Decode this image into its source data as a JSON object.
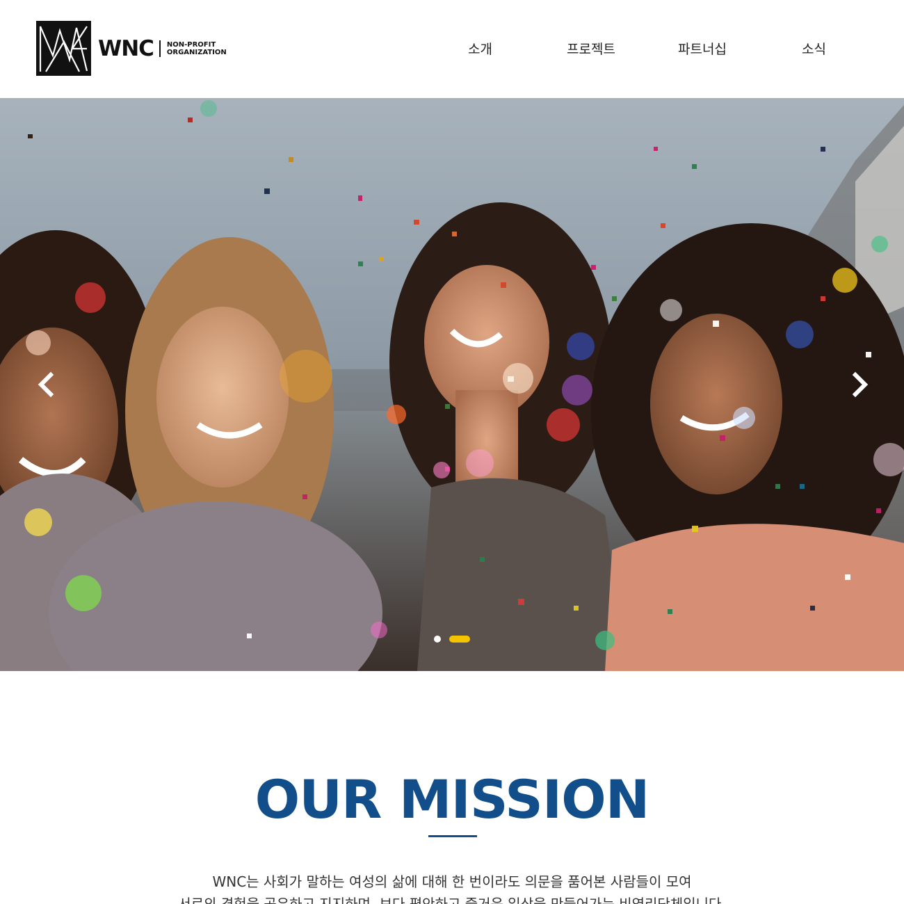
{
  "header": {
    "logo_text": "WNC",
    "logo_sub_line1": "NON-PROFIT",
    "logo_sub_line2": "ORGANIZATION",
    "nav": [
      "소개",
      "프로젝트",
      "파트너십",
      "소식"
    ]
  },
  "hero": {
    "slide_count": 2,
    "active_slide": 2,
    "prev_icon": "chevron-left-icon",
    "next_icon": "chevron-right-icon",
    "accent_color": "#f5c400"
  },
  "mission": {
    "title": "OUR MISSION",
    "title_color": "#124f8a",
    "line1": "WNC는 사회가 말하는 여성의 삶에 대해 한 번이라도 의문을 품어본 사람들이 모여",
    "line2": "서로의 경험을 공유하고 지지하며, 보다 평안하고 즐거운 일상을 만들어가는 비영리단체입니다."
  }
}
